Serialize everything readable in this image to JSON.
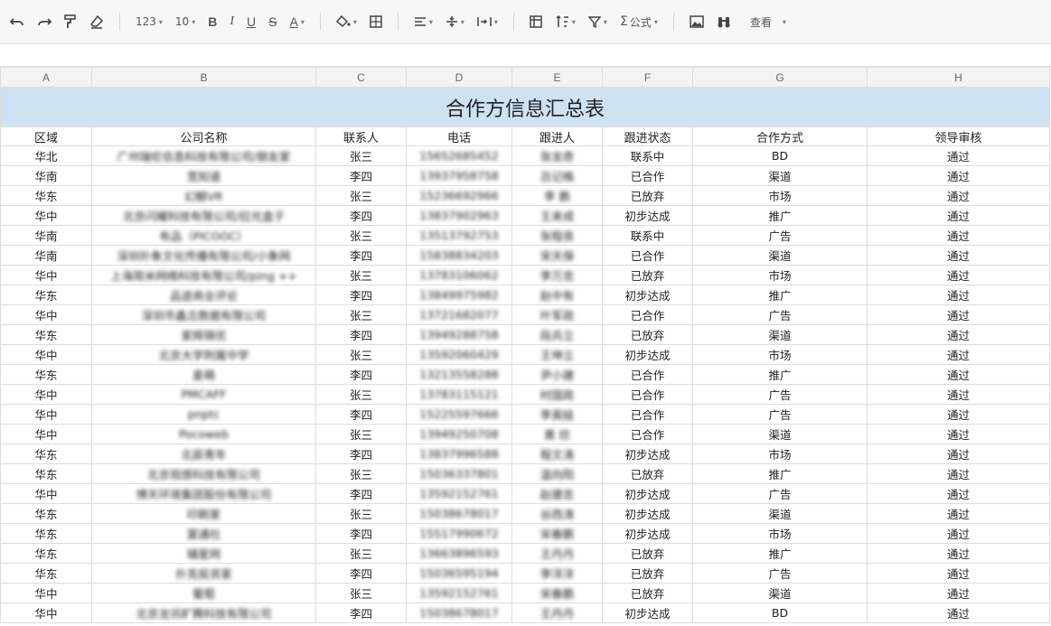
{
  "toolbar": {
    "number_format": "123",
    "font_size": "10",
    "bold": "B",
    "italic": "I",
    "underline": "U",
    "strike": "S",
    "text_color": "A",
    "formula": "公式",
    "view": "查看"
  },
  "sheet": {
    "columns": [
      "A",
      "B",
      "C",
      "D",
      "E",
      "F",
      "G",
      "H"
    ],
    "title": "合作方信息汇总表",
    "headers": [
      "区域",
      "公司名称",
      "联系人",
      "电话",
      "跟进人",
      "跟进状态",
      "合作方式",
      "领导审核"
    ],
    "rows": [
      [
        "华北",
        "广州瑞伦信息科技有限公司/朋友家",
        "张三",
        "15652685452",
        "张龙奇",
        "联系中",
        "BD",
        "通过"
      ],
      [
        "华南",
        "宽知道",
        "李四",
        "13937958758",
        "吕记格",
        "已合作",
        "渠道",
        "通过"
      ],
      [
        "华东",
        "幻鲸VR",
        "张三",
        "15236692966",
        "李 鹏",
        "已放弃",
        "市场",
        "通过"
      ],
      [
        "华中",
        "北京闪耀科技有限公司/拉光盒子",
        "李四",
        "13837902963",
        "王来成",
        "初步达成",
        "推广",
        "通过"
      ],
      [
        "华南",
        "有品（PICOOC）",
        "张三",
        "13513792753",
        "张程良",
        "联系中",
        "广告",
        "通过"
      ],
      [
        "华南",
        "深圳扑象文化传播有限公司/小象网",
        "李四",
        "15838834203",
        "宋天保",
        "已合作",
        "渠道",
        "通过"
      ],
      [
        "华中",
        "上海简米网络科技有限公司/ping ++",
        "张三",
        "13783106062",
        "李万忠",
        "已放弃",
        "市场",
        "通过"
      ],
      [
        "华东",
        "品途商业评论",
        "李四",
        "13849975982",
        "赵中有",
        "初步达成",
        "推广",
        "通过"
      ],
      [
        "华中",
        "深圳市鑫古数据有限公司",
        "张三",
        "13721682077",
        "叶军政",
        "已合作",
        "广告",
        "通过"
      ],
      [
        "华东",
        "家辉锦优",
        "李四",
        "13949288758",
        "段兵立",
        "已放弃",
        "渠道",
        "通过"
      ],
      [
        "华中",
        "北京大学附属中学",
        "张三",
        "13592060429",
        "王坤立",
        "初步达成",
        "市场",
        "通过"
      ],
      [
        "华东",
        "麦萌",
        "李四",
        "13213558288",
        "尹小建",
        "已合作",
        "推广",
        "通过"
      ],
      [
        "华中",
        "PMCAFF",
        "张三",
        "13783115121",
        "时国政",
        "已合作",
        "广告",
        "通过"
      ],
      [
        "华中",
        "pnptc",
        "李四",
        "15225597666",
        "李英娃",
        "已合作",
        "广告",
        "通过"
      ],
      [
        "华中",
        "Pocoweb",
        "张三",
        "13949250708",
        "黄 欣",
        "已合作",
        "渠道",
        "通过"
      ],
      [
        "华东",
        "北辰青年",
        "李四",
        "13837996588",
        "程文涛",
        "初步达成",
        "市场",
        "通过"
      ],
      [
        "华东",
        "北京视感科技有限公司",
        "张三",
        "15036337801",
        "温向阳",
        "已放弃",
        "推广",
        "通过"
      ],
      [
        "华中",
        "博天环境集团股份有限公司",
        "李四",
        "13592152761",
        "赵建忠",
        "初步达成",
        "广告",
        "通过"
      ],
      [
        "华东",
        "印刷家",
        "张三",
        "15038678017",
        "谷西涛",
        "初步达成",
        "渠道",
        "通过"
      ],
      [
        "华东",
        "寞通社",
        "李四",
        "15517990672",
        "宋春鹏",
        "初步达成",
        "市场",
        "通过"
      ],
      [
        "华东",
        "辅星网",
        "张三",
        "13663896593",
        "王丹丹",
        "已放弃",
        "推广",
        "通过"
      ],
      [
        "华东",
        "扑克投资家",
        "李四",
        "15036595194",
        "李洋洋",
        "已放弃",
        "广告",
        "通过"
      ],
      [
        "华中",
        "葡萄",
        "张三",
        "13592152761",
        "宋春鹏",
        "已放弃",
        "渠道",
        "通过"
      ],
      [
        "华中",
        "北京龙讯旷腾科技有限公司",
        "李四",
        "15038678017",
        "王丹丹",
        "初步达成",
        "BD",
        "通过"
      ]
    ]
  }
}
